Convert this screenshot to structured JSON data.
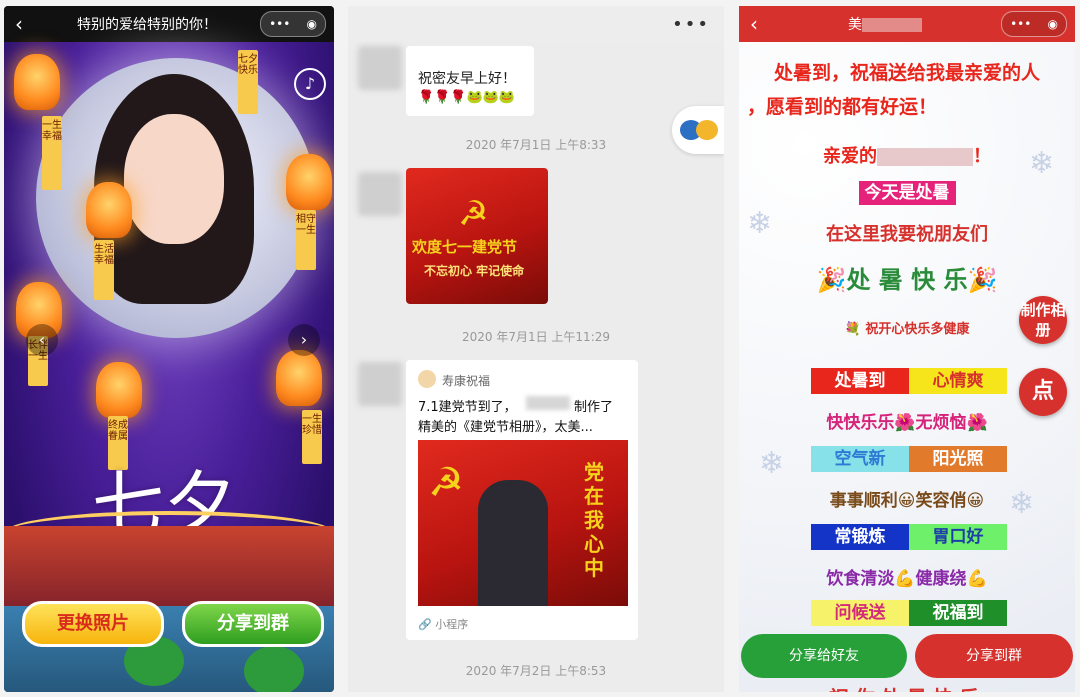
{
  "panel1": {
    "title": "特别的爱给特别的你！",
    "capsule": {
      "more": "•••",
      "close": "◉"
    },
    "banners": [
      "七夕快乐",
      "一生幸福",
      "生活幸福",
      "相守一生",
      "长伴一生",
      "终成眷属",
      "一生珍惜"
    ],
    "headline": "七夕",
    "buttons": {
      "change_photo": "更换照片",
      "share_group": "分享到群"
    }
  },
  "panel2": {
    "top_message": {
      "text": "祝密友早上好！",
      "emoji": "🌹🌹🌹🐸🐸🐸"
    },
    "timestamps": [
      "2020 年7月1日 上午8:33",
      "2020 年7月1日 上午11:29",
      "2020 年7月2日 上午8:53"
    ],
    "image_card": {
      "banner_text": "欢度七一建党节",
      "sub_text": "不忘初心 牢记使命"
    },
    "mini_card": {
      "source": "寿康祝福",
      "desc_a": "7.1建党节到了，",
      "desc_b": "制作了",
      "desc_c": "精美的《建党节相册》，太美...",
      "poster_text": "党在我心中",
      "footer": "小程序"
    }
  },
  "panel3": {
    "title": "美",
    "lines": {
      "l1": "处暑到，祝福送给我最亲爱的人",
      "l2": "，愿看到的都有好运！",
      "dear": "亲爱的",
      "exclaim": "！",
      "today": "今天是处暑",
      "wish": "在这里我要祝朋友们",
      "happy": "处 暑 快 乐",
      "health": "祝开心快乐多健康",
      "happy_free": "快快乐乐🌺无烦恼🌺",
      "smooth": "事事顺利😀笑容俏😀",
      "diet": "饮食清淡💪健康绕💪"
    },
    "pairs": [
      {
        "a": "处暑到",
        "b": "心情爽",
        "ca": "#e8261c",
        "cb": "#f7e51c",
        "ta": "#ffffff",
        "tb": "#d6312c"
      },
      {
        "a": "空气新",
        "b": "阳光照",
        "ca": "#86e2e8",
        "cb": "#e27a2b",
        "ta": "#2b7bd6",
        "tb": "#ffffff"
      },
      {
        "a": "常锻炼",
        "b": "胃口好",
        "ca": "#1434c8",
        "cb": "#6ff06a",
        "ta": "#ffffff",
        "tb": "#1d3fa8"
      },
      {
        "a": "问候送",
        "b": "祝福到",
        "ca": "#f6f26a",
        "cb": "#1f8f2a",
        "ta": "#d42a7a",
        "tb": "#ffffff"
      }
    ],
    "side": {
      "make": "制作相册",
      "click": "点"
    },
    "buttons": {
      "share_friend": "分享给好友",
      "share_group": "分享到群"
    },
    "bottom_peek": "祝你处暑快乐"
  }
}
